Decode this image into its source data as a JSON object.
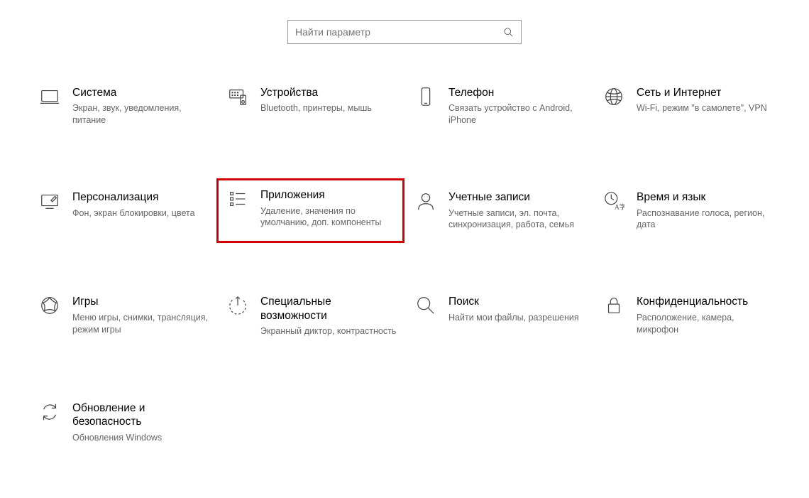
{
  "search": {
    "placeholder": "Найти параметр"
  },
  "tiles": {
    "system": {
      "title": "Система",
      "desc": "Экран, звук, уведомления, питание"
    },
    "devices": {
      "title": "Устройства",
      "desc": "Bluetooth, принтеры, мышь"
    },
    "phone": {
      "title": "Телефон",
      "desc": "Связать устройство с Android, iPhone"
    },
    "network": {
      "title": "Сеть и Интернет",
      "desc": "Wi-Fi, режим \"в самолете\", VPN"
    },
    "personal": {
      "title": "Персонализация",
      "desc": "Фон, экран блокировки, цвета"
    },
    "apps": {
      "title": "Приложения",
      "desc": "Удаление, значения по умолчанию, доп. компоненты"
    },
    "accounts": {
      "title": "Учетные записи",
      "desc": "Учетные записи, эл. почта, синхронизация, работа, семья"
    },
    "time": {
      "title": "Время и язык",
      "desc": "Распознавание голоса, регион, дата"
    },
    "gaming": {
      "title": "Игры",
      "desc": "Меню игры, снимки, трансляция, режим игры"
    },
    "ease": {
      "title": "Специальные возможности",
      "desc": "Экранный диктор, контрастность"
    },
    "search_tile": {
      "title": "Поиск",
      "desc": "Найти мои файлы, разрешения"
    },
    "privacy": {
      "title": "Конфиденциальность",
      "desc": "Расположение, камера, микрофон"
    },
    "update": {
      "title": "Обновление и безопасность",
      "desc": "Обновления Windows"
    }
  }
}
